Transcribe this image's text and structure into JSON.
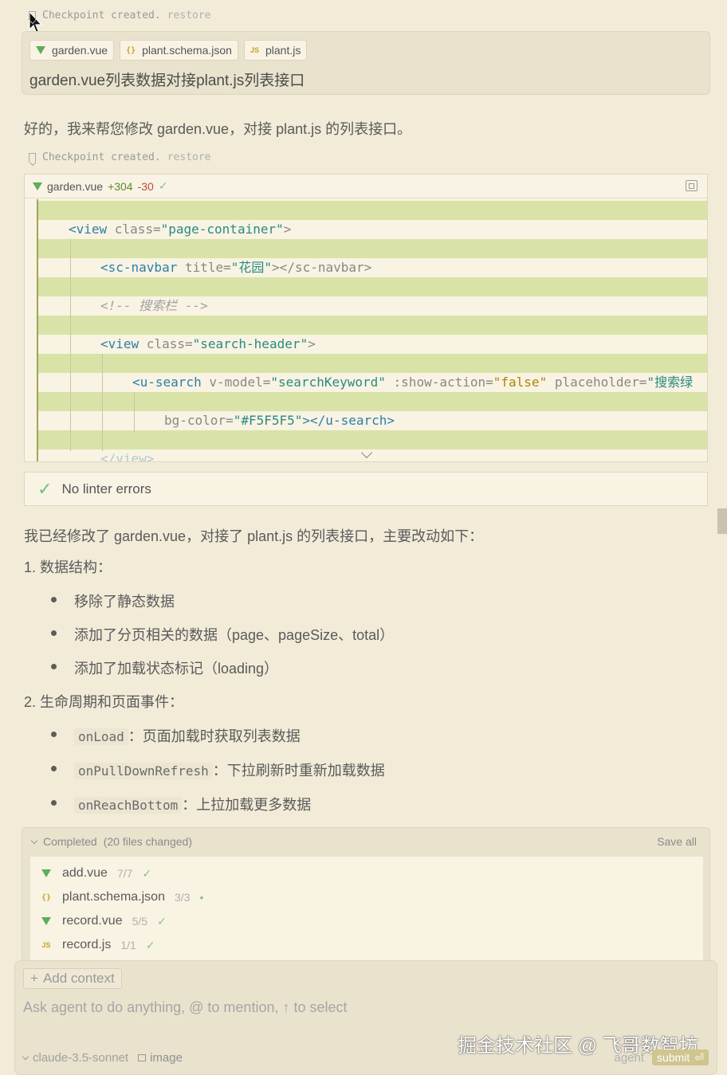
{
  "checkpoint": {
    "text": "Checkpoint created.",
    "restore": "restore"
  },
  "user_message": {
    "chips": [
      {
        "icon": "vue-icon",
        "label": "garden.vue"
      },
      {
        "icon": "json-icon",
        "label": "plant.schema.json"
      },
      {
        "icon": "js-icon",
        "label": "plant.js"
      }
    ],
    "text": "garden.vue列表数据对接plant.js列表接口"
  },
  "assistant_intro": "好的，我来帮您修改 garden.vue，对接 plant.js 的列表接口。",
  "code_card": {
    "filename": "garden.vue",
    "additions": "+304",
    "deletions": "-30",
    "lines": {
      "l1": {
        "tag": "<view",
        "attr": " class=",
        "val": "\"page-container\"",
        "end": ">"
      },
      "l2": {
        "tag": "<sc-navbar",
        "attr": " title=",
        "val": "\"花园\"",
        "end": "></sc-navbar>"
      },
      "l3": {
        "comment": "<!-- 搜索栏 -->"
      },
      "l4": {
        "tag": "<view",
        "attr": " class=",
        "val": "\"search-header\"",
        "end": ">"
      },
      "l5": {
        "tag": "<u-search",
        "attr1": " v-model=",
        "val1": "\"searchKeyword\"",
        "attr2": " :show-action=",
        "val2": "\"false\"",
        "attr3": " placeholder=",
        "val3": "\"搜索绿"
      },
      "l6": {
        "attr": "bg-color=",
        "val": "\"#F5F5F5\"",
        "end": "></u-search>"
      },
      "l7": {
        "tag": "</view>"
      }
    }
  },
  "linter": "No linter errors",
  "summary": {
    "intro": "我已经修改了 garden.vue，对接了 plant.js 的列表接口，主要改动如下：",
    "section1": "1. 数据结构：",
    "s1_items": [
      "移除了静态数据",
      "添加了分页相关的数据（page、pageSize、total）",
      "添加了加载状态标记（loading）"
    ],
    "section2": "2. 生命周期和页面事件：",
    "s2_items": [
      {
        "code": "onLoad",
        "text": "：页面加载时获取列表数据"
      },
      {
        "code": "onPullDownRefresh",
        "text": "：下拉刷新时重新加载数据"
      },
      {
        "code": "onReachBottom",
        "text": "：上拉加载更多数据"
      }
    ]
  },
  "completed": {
    "title": "Completed",
    "count": "(20 files changed)",
    "save_all": "Save all",
    "files": [
      {
        "icon": "vue-icon",
        "name": "add.vue",
        "count": "7/7",
        "status": "✓"
      },
      {
        "icon": "json-icon",
        "name": "plant.schema.json",
        "count": "3/3",
        "status": "•"
      },
      {
        "icon": "vue-icon",
        "name": "record.vue",
        "count": "5/5",
        "status": "✓"
      },
      {
        "icon": "js-icon",
        "name": "record.js",
        "count": "1/1",
        "status": "✓"
      }
    ]
  },
  "composer": {
    "add_context": "Add context",
    "placeholder": "Ask agent to do anything, @ to mention, ↑ to select",
    "model": "claude-3.5-sonnet",
    "image": "image",
    "mode": "agent",
    "submit": "submit",
    "watermark": "掘金技术社区 @ 飞哥数智坊"
  }
}
